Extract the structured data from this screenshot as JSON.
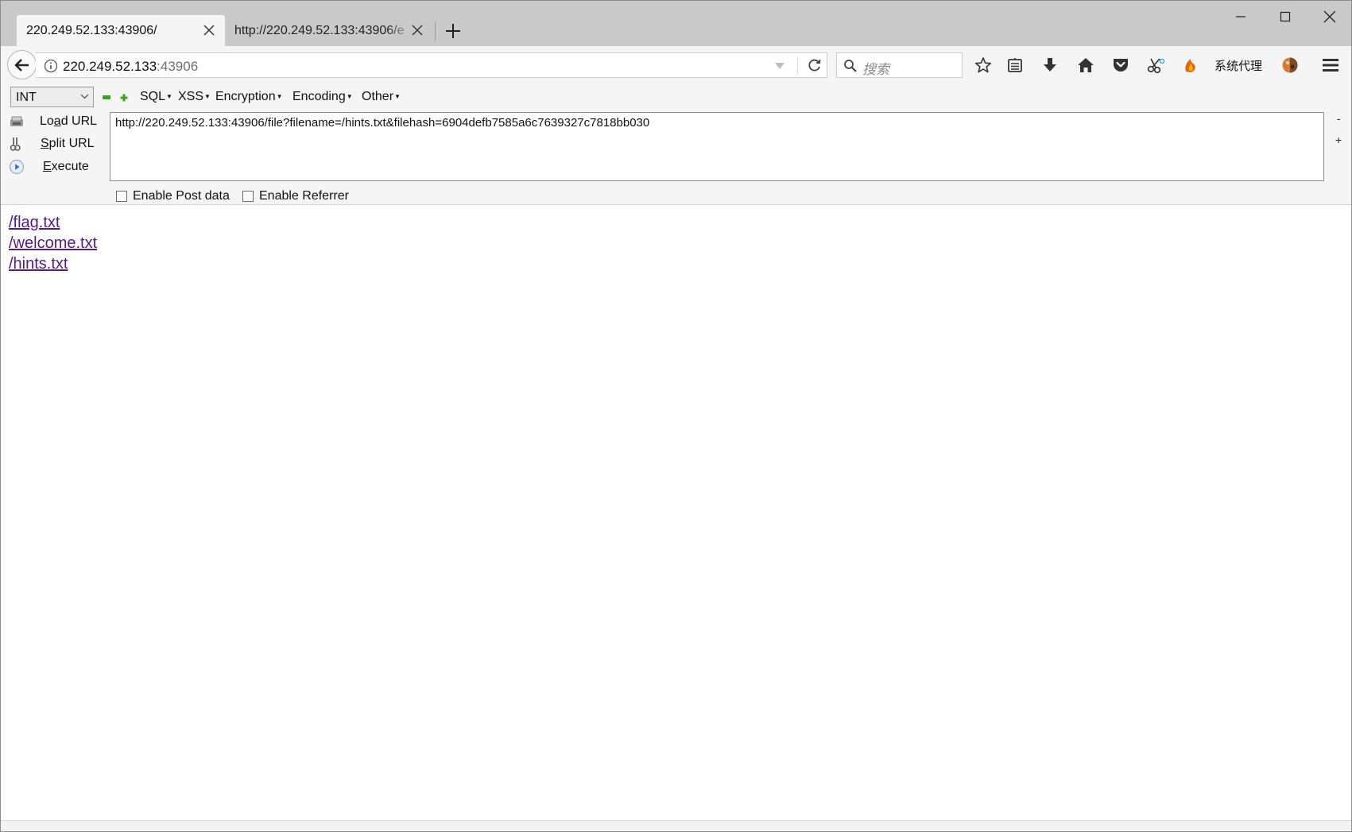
{
  "tabs": [
    {
      "title": "220.249.52.133:43906/",
      "active": true
    },
    {
      "title": "http://220.249.52.133:43906/e",
      "active": false
    }
  ],
  "address_bar": {
    "host": "220.249.52.133",
    "port": ":43906"
  },
  "search": {
    "placeholder": "搜索"
  },
  "toolbar": {
    "proxy_label": "系统代理"
  },
  "hackbar": {
    "select_value": "INT",
    "menus": {
      "sql": "SQL",
      "xss": "XSS",
      "encryption": "Encryption",
      "encoding": "Encoding",
      "other": "Other"
    },
    "load_url": {
      "pre": "Lo",
      "key": "a",
      "post": "d URL"
    },
    "split_url": {
      "key": "S",
      "post": "plit URL"
    },
    "execute": {
      "key": "E",
      "post": "xecute"
    },
    "url_value": "http://220.249.52.133:43906/file?filename=/hints.txt&filehash=6904defb7585a6c7639327c7818bb030",
    "zoom_minus": "-",
    "zoom_plus": "+",
    "enable_post": "Enable Post data",
    "enable_referrer": "Enable Referrer"
  },
  "content": {
    "links": [
      "/flag.txt",
      "/welcome.txt",
      "/hints.txt"
    ]
  },
  "colors": {
    "visited_link": "#551a8b",
    "tab_strip": "#c9c9c9",
    "toolbar_bg": "#f5f5f5"
  }
}
